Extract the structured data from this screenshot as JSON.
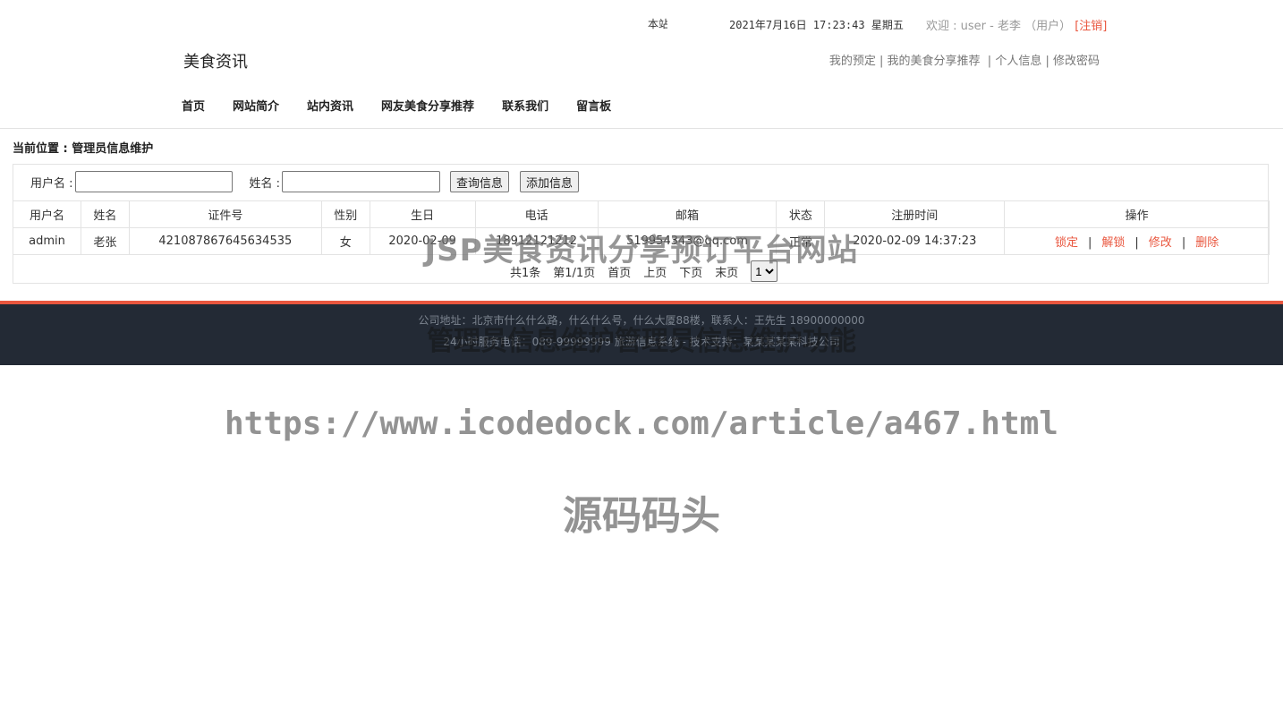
{
  "top": {
    "truncated_text": "本站",
    "datetime": "2021年7月16日 17:23:43 星期五",
    "welcome_prefix": "欢迎 : user - 老李 （用户）",
    "logout_label": "[注销]"
  },
  "header": {
    "site_title": "美食资讯",
    "user_links": [
      "我的预定",
      "我的美食分享推荐",
      "个人信息",
      "修改密码"
    ]
  },
  "nav": [
    "首页",
    "网站简介",
    "站内资讯",
    "网友美食分享推荐",
    "联系我们",
    "留言板"
  ],
  "breadcrumb": "当前位置 : 管理员信息维护",
  "search": {
    "username_label": "用户名 :",
    "username_value": "",
    "name_label": "姓名 :",
    "name_value": "",
    "query_button": "查询信息",
    "add_button": "添加信息"
  },
  "table": {
    "headers": [
      "用户名",
      "姓名",
      "证件号",
      "性别",
      "生日",
      "电话",
      "邮箱",
      "状态",
      "注册时间",
      "操作"
    ],
    "rows": [
      {
        "username": "admin",
        "name": "老张",
        "id_number": "421087867645634535",
        "gender": "女",
        "birthday": "2020-02-09",
        "phone": "18912121212",
        "email": "519954343@qq.com",
        "status": "正常",
        "registered": "2020-02-09 14:37:23",
        "actions": [
          "锁定",
          "解锁",
          "修改",
          "删除"
        ]
      }
    ]
  },
  "pager": {
    "total": "共1条",
    "page_info": "第1/1页",
    "first": "首页",
    "prev": "上页",
    "next": "下页",
    "last": "末页",
    "selected_page": "1"
  },
  "footer": {
    "line1": "公司地址：北京市什么什么路，什么什么号，什么大厦88楼，联系人：王先生 18900000000",
    "line2": "24小时服务电话：089-99999999  旅游信息系统 - 技术支持：某某某某某科技公司"
  },
  "watermarks": {
    "title": "JSP美食资讯分享预订平台网站",
    "footer_overlay": "管理员信息维护管理员信息维护功能",
    "url": "https://www.icodedock.com/article/a467.html",
    "brand": "源码码头"
  },
  "colors": {
    "accent": "#e9573f",
    "footer_bg": "#232a35",
    "border": "#e3e3e3"
  }
}
